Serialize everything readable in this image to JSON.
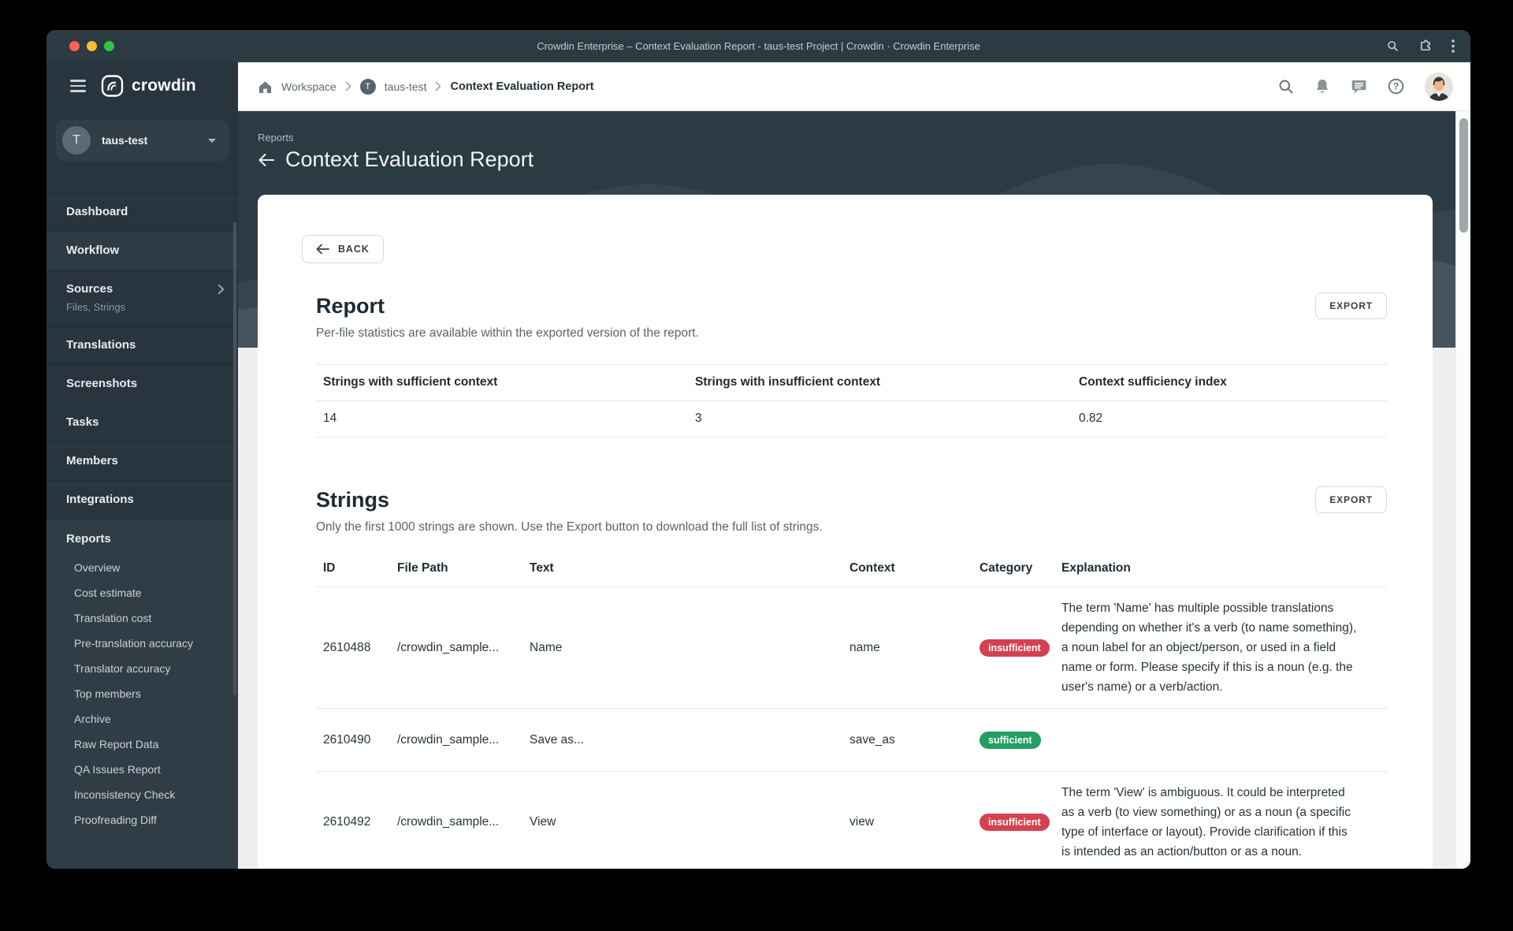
{
  "window": {
    "title": "Crowdin Enterprise – Context Evaluation Report - taus-test Project | Crowdin · Crowdin Enterprise",
    "titlebar_icons": [
      "search-icon",
      "extensions-icon",
      "kebab-menu-icon"
    ]
  },
  "sidebar": {
    "brand": "crowdin",
    "project": {
      "name": "taus-test",
      "initial": "T"
    },
    "items": [
      {
        "label": "Dashboard"
      },
      {
        "label": "Workflow",
        "highlighted": true
      },
      {
        "label": "Sources",
        "sublabel": "Files, Strings",
        "chevron": true
      },
      {
        "label": "Translations"
      },
      {
        "label": "Screenshots"
      },
      {
        "label": "Tasks"
      },
      {
        "label": "Members"
      },
      {
        "label": "Integrations"
      }
    ],
    "reports": {
      "label": "Reports",
      "items": [
        "Overview",
        "Cost estimate",
        "Translation cost",
        "Pre-translation accuracy",
        "Translator accuracy",
        "Top members",
        "Archive",
        "Raw Report Data",
        "QA Issues Report",
        "Inconsistency Check",
        "Proofreading Diff"
      ]
    }
  },
  "topbar": {
    "breadcrumb": {
      "workspace": "Workspace",
      "project": "taus-test",
      "project_initial": "T",
      "page": "Context Evaluation Report"
    },
    "action_icons": [
      "search-icon",
      "bell-icon",
      "chat-icon",
      "help-icon",
      "user-avatar"
    ]
  },
  "page": {
    "eyebrow": "Reports",
    "title": "Context Evaluation Report",
    "back_label": "BACK",
    "report": {
      "heading": "Report",
      "export_label": "EXPORT",
      "subtitle": "Per-file statistics are available within the exported version of the report.",
      "stats": {
        "columns": [
          "Strings with sufficient context",
          "Strings with insufficient context",
          "Context sufficiency index"
        ],
        "values": [
          "14",
          "3",
          "0.82"
        ]
      }
    },
    "strings": {
      "heading": "Strings",
      "export_label": "EXPORT",
      "subtitle": "Only the first 1000 strings are shown. Use the Export button to download the full list of strings.",
      "columns": [
        "ID",
        "File Path",
        "Text",
        "Context",
        "Category",
        "Explanation"
      ],
      "rows": [
        {
          "id": "2610488",
          "file_path": "/crowdin_sample...",
          "text": "Name",
          "context": "name",
          "category": "insufficient",
          "explanation": "The term 'Name' has multiple possible translations depending on whether it's a verb (to name something), a noun label for an object/person, or used in a field name or form. Please specify if this is a noun (e.g. the user's name) or a verb/action."
        },
        {
          "id": "2610490",
          "file_path": "/crowdin_sample...",
          "text": "Save as...",
          "context": "save_as",
          "category": "sufficient",
          "explanation": ""
        },
        {
          "id": "2610492",
          "file_path": "/crowdin_sample...",
          "text": "View",
          "context": "view",
          "category": "insufficient",
          "explanation": "The term 'View' is ambiguous. It could be interpreted as a verb (to view something) or as a noun (a specific type of interface or layout). Provide clarification if this is intended as an action/button or as a noun."
        }
      ]
    }
  },
  "colors": {
    "badge_insufficient": "#d54150",
    "badge_sufficient": "#249e61",
    "chrome_dark": "#2c3a44",
    "sidebar_dark": "#28343e",
    "reports_section": "#303d47"
  }
}
